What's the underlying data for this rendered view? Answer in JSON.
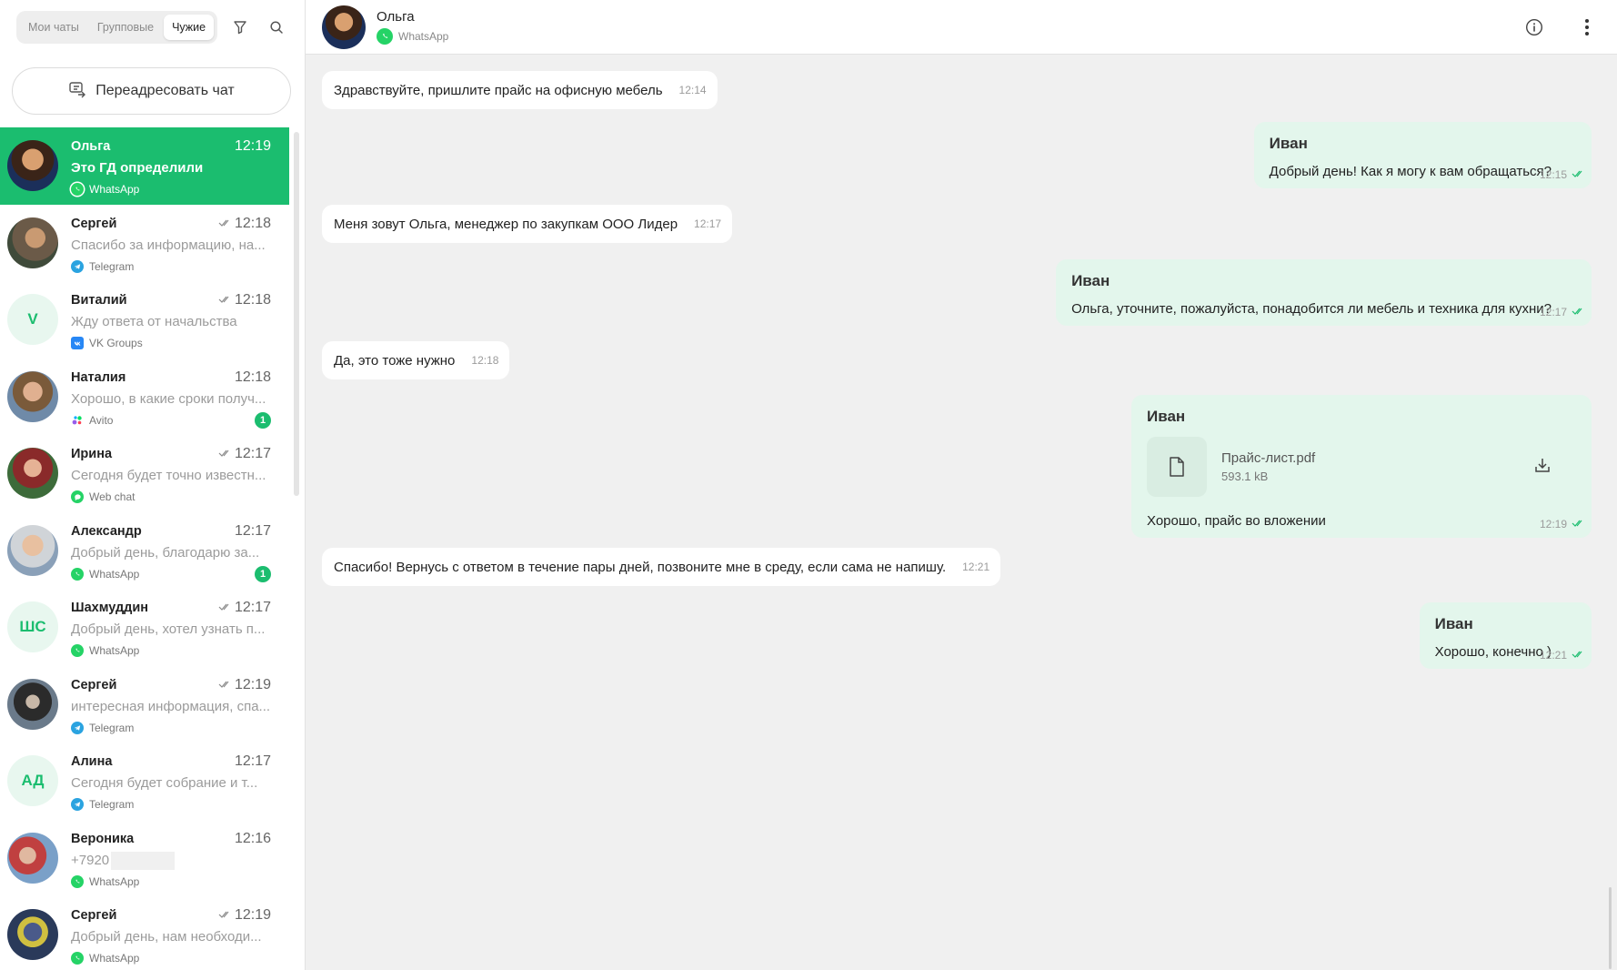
{
  "sidebar": {
    "tabs": [
      {
        "label": "Мои чаты",
        "active": false
      },
      {
        "label": "Групповые",
        "active": false
      },
      {
        "label": "Чужие",
        "active": true
      }
    ],
    "forward_button": "Переадресовать чат",
    "chats": [
      {
        "name": "Ольга",
        "time": "12:19",
        "preview": "Это ГД определили",
        "source": "WhatsApp",
        "active": true,
        "read": false,
        "unread": null
      },
      {
        "name": "Сергей",
        "time": "12:18",
        "preview": "Спасибо за информацию, на...",
        "source": "Telegram",
        "active": false,
        "read": true,
        "unread": null
      },
      {
        "name": "Виталий",
        "time": "12:18",
        "preview": "Жду ответа от начальства",
        "source": "VK Groups",
        "active": false,
        "read": true,
        "unread": null,
        "initials": "V"
      },
      {
        "name": "Наталия",
        "time": "12:18",
        "preview": "Хорошо, в какие сроки получ...",
        "source": "Avito",
        "active": false,
        "read": false,
        "unread": "1"
      },
      {
        "name": "Ирина",
        "time": "12:17",
        "preview": "Сегодня будет точно известн...",
        "source": "Web chat",
        "active": false,
        "read": true,
        "unread": null
      },
      {
        "name": "Александр",
        "time": "12:17",
        "preview": "Добрый день, благодарю за...",
        "source": "WhatsApp",
        "active": false,
        "read": false,
        "unread": "1"
      },
      {
        "name": "Шахмуддин",
        "time": "12:17",
        "preview": "Добрый день, хотел узнать п...",
        "source": "WhatsApp",
        "active": false,
        "read": true,
        "unread": null,
        "initials": "ШС"
      },
      {
        "name": "Сергей",
        "time": "12:19",
        "preview": "интересная информация, спа...",
        "source": "Telegram",
        "active": false,
        "read": true,
        "unread": null
      },
      {
        "name": "Алина",
        "time": "12:17",
        "preview": "Сегодня будет собрание и т...",
        "source": "Telegram",
        "active": false,
        "read": false,
        "unread": null,
        "initials": "АД"
      },
      {
        "name": "Вероника",
        "time": "12:16",
        "preview": "+7920",
        "source": "WhatsApp",
        "active": false,
        "read": false,
        "unread": null,
        "masked": true
      },
      {
        "name": "Сергей",
        "time": "12:19",
        "preview": "Добрый день, нам необходи...",
        "source": "WhatsApp",
        "active": false,
        "read": true,
        "unread": null
      }
    ]
  },
  "header": {
    "name": "Ольга",
    "source": "WhatsApp"
  },
  "messages": [
    {
      "dir": "in",
      "text": "Здравствуйте, пришлите прайс на офисную мебель",
      "time": "12:14"
    },
    {
      "dir": "out",
      "author": "Иван",
      "text": "Добрый день! Как я могу к вам обращаться?",
      "time": "12:15"
    },
    {
      "dir": "in",
      "text": "Меня зовут Ольга, менеджер по закупкам ООО Лидер",
      "time": "12:17"
    },
    {
      "dir": "out",
      "author": "Иван",
      "text": "Ольга, уточните, пожалуйста, понадобится ли мебель и техника для кухни?",
      "time": "12:17"
    },
    {
      "dir": "in",
      "text": "Да, это тоже нужно",
      "time": "12:18"
    },
    {
      "dir": "out",
      "author": "Иван",
      "text": "Хорошо, прайс во вложении",
      "time": "12:19",
      "file": {
        "name": "Прайс-лист.pdf",
        "size": "593.1 kB"
      }
    },
    {
      "dir": "in",
      "text": "Спасибо! Вернусь с ответом в течение пары дней, позвоните мне в среду, если сама не напишу.",
      "time": "12:21"
    },
    {
      "dir": "out",
      "author": "Иван",
      "text": "Хорошо, конечно )",
      "time": "12:21"
    }
  ],
  "colors": {
    "accent": "#1bbd6f",
    "outgoing_bubble": "#e3f6ec",
    "whatsapp": "#25d366",
    "telegram": "#2aa3e0",
    "vk": "#2787f5"
  }
}
